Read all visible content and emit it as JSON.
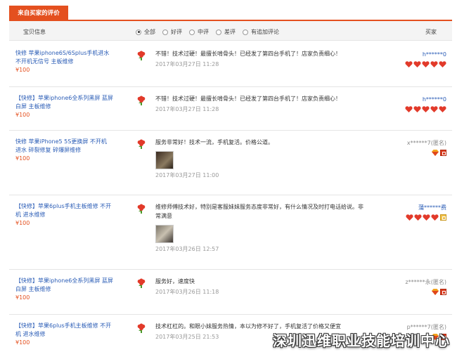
{
  "tab": {
    "label": "来自买家的评价"
  },
  "header": {
    "item_col": "宝贝信息",
    "buyer_col": "买家",
    "filters": [
      {
        "label": "全部",
        "selected": true
      },
      {
        "label": "好评",
        "selected": false
      },
      {
        "label": "中评",
        "selected": false
      },
      {
        "label": "差评",
        "selected": false
      },
      {
        "label": "有追加评论",
        "selected": false
      }
    ]
  },
  "reviews": [
    {
      "item_title": "快修 苹果iphone6S/6Splus手机进水不开机无信号 主板维修",
      "item_price": "¥100",
      "text": "不错！技术过硬！最擅长啃骨头！已经发了第四台手机了！店家负责细心！",
      "date": "2017年03月27日 11:28",
      "buyer": "h******0",
      "rank": "hearts5",
      "has_image": false
    },
    {
      "item_title": "【快修】苹果iphone6全系列黑屏 蓝屏 白屏 主板维修",
      "item_price": "¥100",
      "text": "不错！技术过硬！最擅长啃骨头！已经发了第四台手机了！店家负责细心！",
      "date": "2017年03月27日 11:28",
      "buyer": "h******0",
      "rank": "hearts5",
      "has_image": false
    },
    {
      "item_title": "快修 苹果iPhone5 5S更换屏 不开机 进水 碎裂修复 碎爆屏维修",
      "item_price": "¥100",
      "text": "服务非常好！技术一流，手机复活。价格公道。",
      "date": "2017年03月27日 11:00",
      "buyer": "x******7(匿名)",
      "rank": "gem1",
      "has_image": true
    },
    {
      "item_title": "【快修】苹果6plus手机主板维修 不开机 进水维修",
      "item_price": "¥100",
      "text": "维修师傅技术好，特别是客服妹妹服务态度非常好，有什么情况及时打电话给说。非常满意",
      "date": "2017年03月26日 12:57",
      "buyer": "蒲******费",
      "rank": "hearts4",
      "has_image": true
    },
    {
      "item_title": "【快修】苹果iphone6全系列黑屏 蓝屏 白屏 主板维修",
      "item_price": "¥100",
      "text": "服务好，速度快",
      "date": "2017年03月26日 11:18",
      "buyer": "z******永(匿名)",
      "rank": "gem1",
      "has_image": false
    },
    {
      "item_title": "【快修】苹果6plus手机主板维修 不开机 进水维修",
      "item_price": "¥100",
      "text": "技术杠杠的。和眼小妹服务热情，本以为修不好了，手机复活了价格又便宜",
      "date": "2017年03月25日 21:53",
      "buyer": "p******7(匿名)",
      "rank": "gem1",
      "has_image": false
    }
  ],
  "watermark": "深圳迅维职业技能培训中心",
  "colors": {
    "accent": "#e4501f",
    "link": "#2a5cb6",
    "muted": "#999999"
  }
}
